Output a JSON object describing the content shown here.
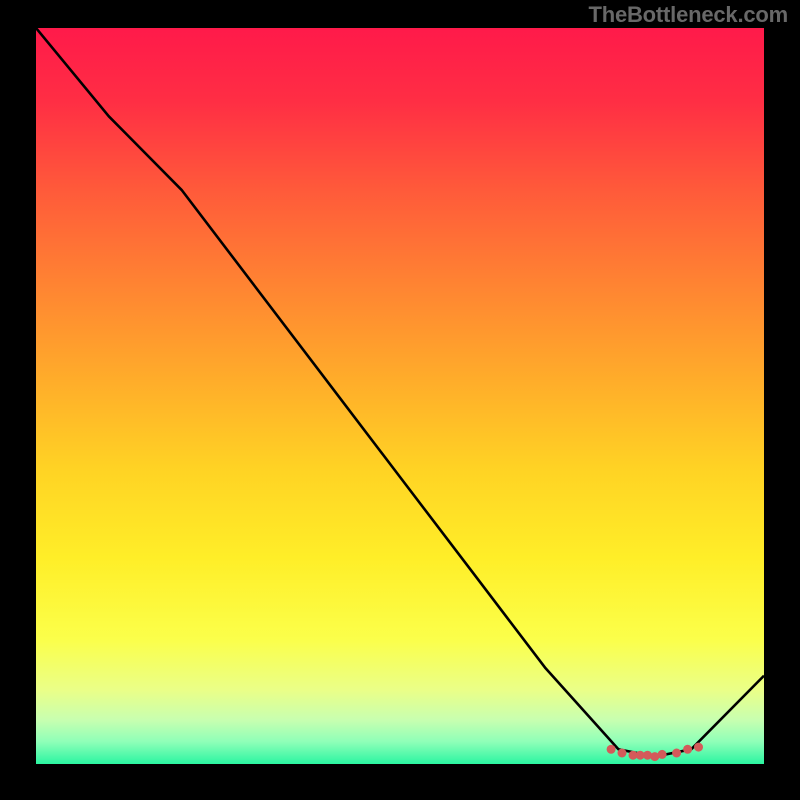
{
  "watermark": "TheBottleneck.com",
  "chart_data": {
    "type": "line",
    "title": "",
    "xlabel": "",
    "ylabel": "",
    "x": [
      0,
      10,
      20,
      30,
      40,
      50,
      60,
      70,
      80,
      85,
      90,
      100
    ],
    "values": [
      100,
      88,
      78,
      65,
      52,
      39,
      26,
      13,
      2,
      1,
      2,
      12
    ],
    "xlim": [
      0,
      100
    ],
    "ylim": [
      0,
      100
    ],
    "markers": {
      "x": [
        79,
        80.5,
        82,
        83,
        84,
        85,
        86,
        88,
        89.5,
        91
      ],
      "y": [
        2,
        1.5,
        1.2,
        1.2,
        1.2,
        1,
        1.3,
        1.5,
        2,
        2.3
      ]
    },
    "background": "rainbow-vertical-gradient",
    "annotations": []
  }
}
